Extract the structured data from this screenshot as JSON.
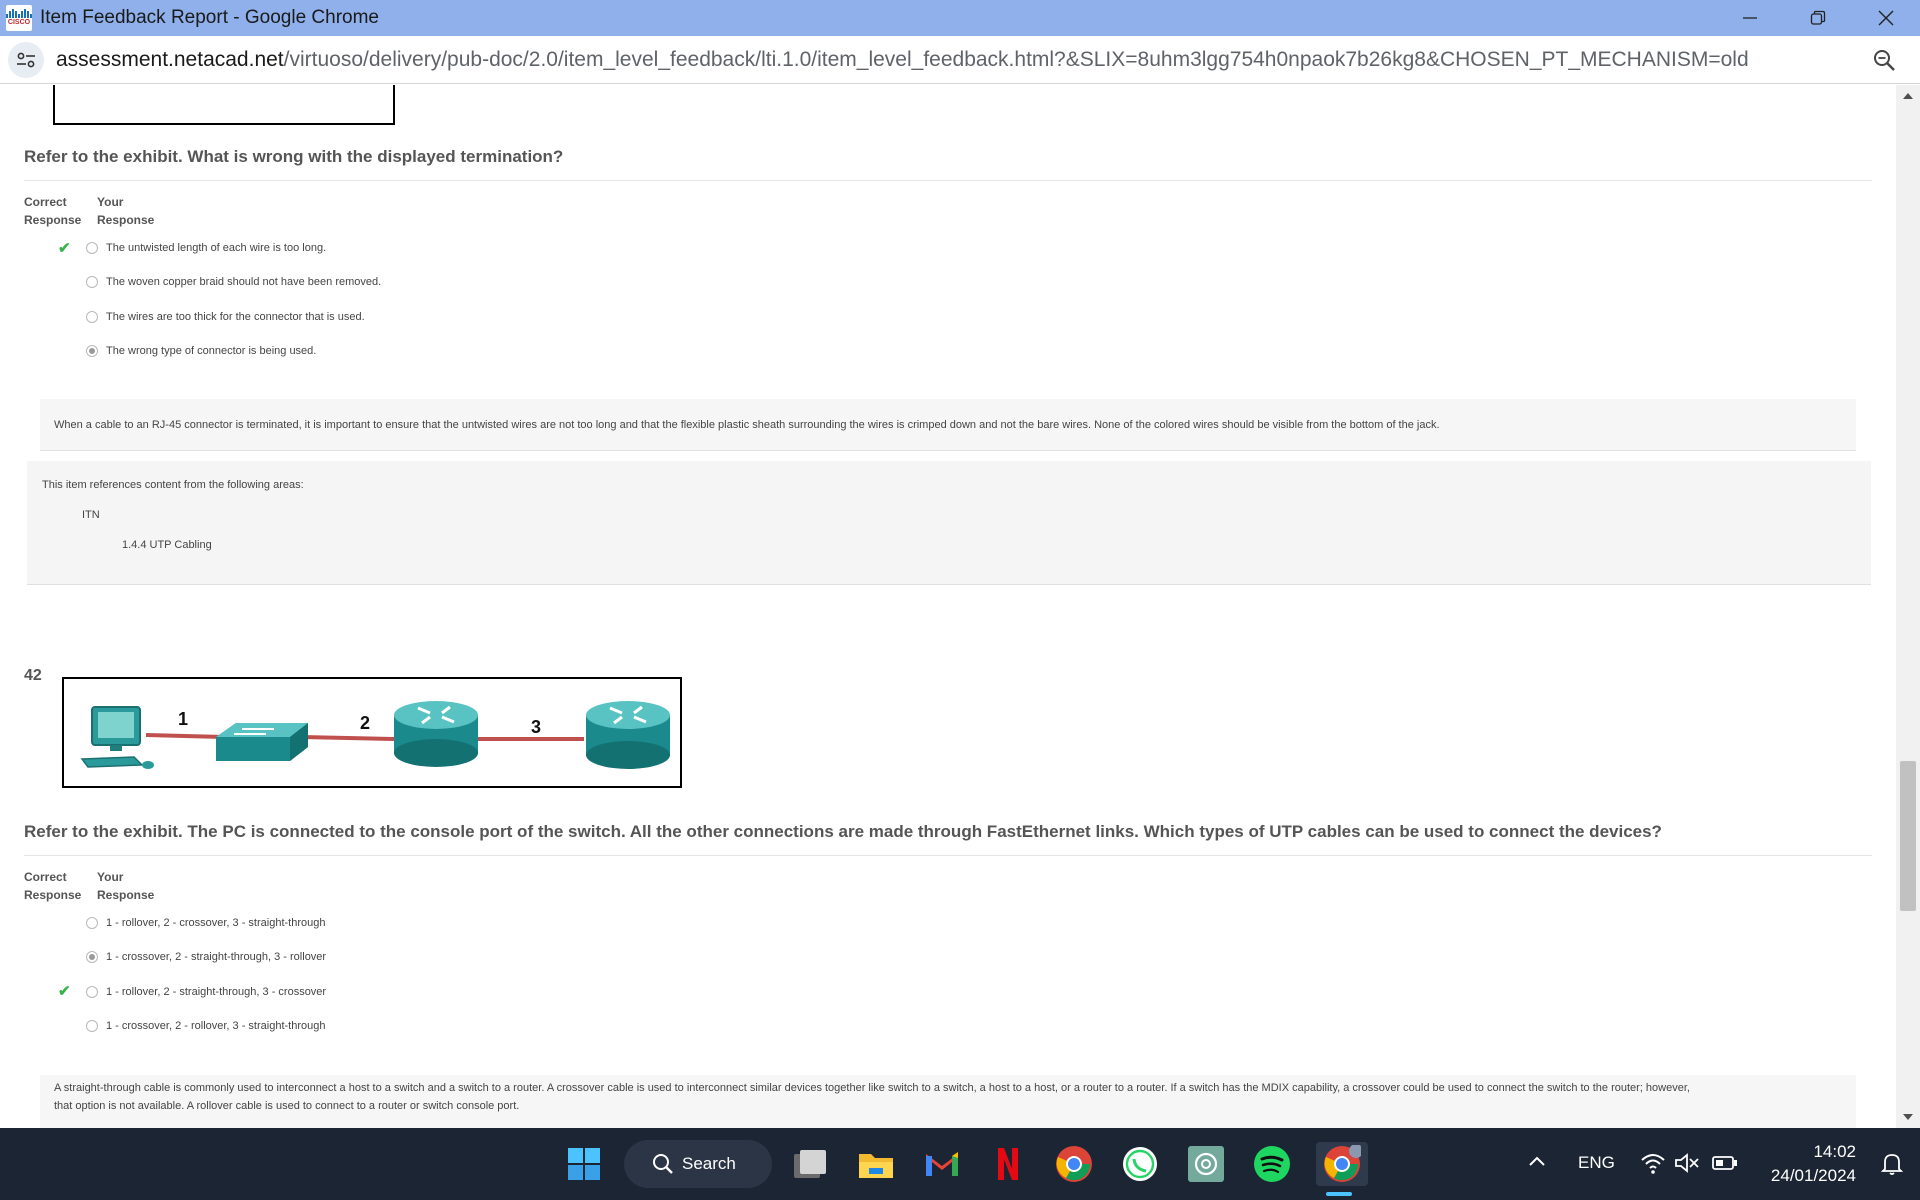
{
  "window": {
    "title": "Item Feedback Report - Google Chrome",
    "logo_text": "CISCO"
  },
  "address": {
    "host": "assessment.netacad.net",
    "path": "/virtuoso/delivery/pub-doc/2.0/item_level_feedback/lti.1.0/item_level_feedback.html?&SLIX=8uhm3lgg754h0npaok7b26kg8&CHOSEN_PT_MECHANISM=old"
  },
  "q41": {
    "question": "Refer to the exhibit. What is wrong with the displayed termination?",
    "col_correct": [
      "Correct",
      "Response"
    ],
    "col_your": [
      "Your",
      "Response"
    ],
    "options": [
      {
        "text": "The untwisted length of each wire is too long.",
        "correct": true,
        "selected": false
      },
      {
        "text": "The woven copper braid should not have been removed.",
        "correct": false,
        "selected": false
      },
      {
        "text": "The wires are too thick for the connector that is used.",
        "correct": false,
        "selected": false
      },
      {
        "text": "The wrong type of connector is being used.",
        "correct": false,
        "selected": true
      }
    ],
    "explanation": "When a cable to an RJ-45 connector is terminated, it is important to ensure that the untwisted wires are not too long and that the flexible plastic sheath surrounding the wires is crimped down and not the bare wires. None of the colored wires should be visible from the bottom of the jack.",
    "ref_intro": "This item references content from the following areas:",
    "ref_course": "ITN",
    "ref_topic": "1.4.4 UTP Cabling"
  },
  "q42": {
    "number": "42",
    "exhibit_labels": [
      "1",
      "2",
      "3"
    ],
    "question": "Refer to the exhibit. The PC is connected to the console port of the switch. All the other connections are made through FastEthernet links. Which types of UTP cables can be used to connect the devices?",
    "col_correct": [
      "Correct",
      "Response"
    ],
    "col_your": [
      "Your",
      "Response"
    ],
    "options": [
      {
        "text": "1 - rollover, 2 - crossover, 3 - straight-through",
        "correct": false,
        "selected": false
      },
      {
        "text": "1 - crossover, 2 - straight-through, 3 - rollover",
        "correct": false,
        "selected": true
      },
      {
        "text": "1 - rollover, 2 - straight-through, 3 - crossover",
        "correct": true,
        "selected": false
      },
      {
        "text": "1 - crossover, 2 - rollover, 3 - straight-through",
        "correct": false,
        "selected": false
      }
    ],
    "explanation_1": "A straight-through cable is commonly used to interconnect a host to a switch and a switch to a router. A crossover cable is used to interconnect similar devices together like switch to a switch, a host to a host, or a router to a router. If a switch has the MDIX capability, a crossover could be used to connect the switch to the router; however,",
    "explanation_2": "that option is not available. A rollover cable is used to connect to a router or switch console port."
  },
  "taskbar": {
    "search_label": "Search",
    "language": "ENG",
    "time": "14:02",
    "date": "24/01/2024",
    "apps": [
      "windows-start",
      "task-view",
      "file-explorer",
      "gmail",
      "netflix",
      "chrome",
      "whatsapp",
      "chatgpt",
      "spotify",
      "chrome-active"
    ]
  },
  "colors": {
    "titlebar": "#8fb0ea",
    "check": "#3ab54a",
    "taskbar": "#1c2533",
    "cable": "#c0504d",
    "device": "#1a8a8c"
  }
}
